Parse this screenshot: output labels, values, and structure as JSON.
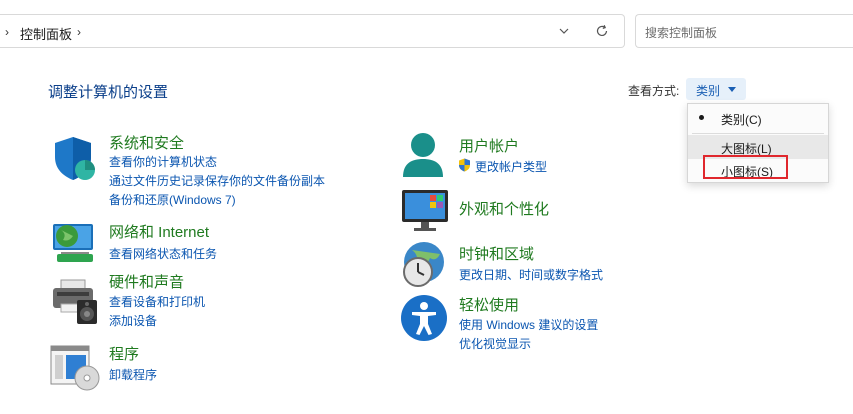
{
  "address": {
    "breadcrumb": "控制面板"
  },
  "search": {
    "placeholder": "搜索控制面板"
  },
  "heading": "调整计算机的设置",
  "view_by": {
    "label": "查看方式:",
    "current": "类别",
    "options": [
      "类别(C)",
      "大图标(L)",
      "小图标(S)"
    ],
    "selected_index": 0,
    "hover_index": 1,
    "highlighted_index": 2
  },
  "categories_left": [
    {
      "title": "系统和安全",
      "icon": "shield-icon",
      "links": [
        "查看你的计算机状态",
        "通过文件历史记录保存你的文件备份副本",
        "备份和还原(Windows 7)"
      ]
    },
    {
      "title": "网络和 Internet",
      "icon": "network-globe-icon",
      "links": [
        "查看网络状态和任务"
      ]
    },
    {
      "title": "硬件和声音",
      "icon": "printer-speaker-icon",
      "links": [
        "查看设备和打印机",
        "添加设备"
      ]
    },
    {
      "title": "程序",
      "icon": "programs-disc-icon",
      "links": [
        "卸载程序"
      ]
    }
  ],
  "categories_right": [
    {
      "title": "用户帐户",
      "icon": "user-icon",
      "links": [
        "更改帐户类型"
      ],
      "link_icon": "uac-shield-icon"
    },
    {
      "title": "外观和个性化",
      "icon": "monitor-icon",
      "links": []
    },
    {
      "title": "时钟和区域",
      "icon": "clock-globe-icon",
      "links": [
        "更改日期、时间或数字格式"
      ]
    },
    {
      "title": "轻松使用",
      "icon": "accessibility-icon",
      "links": [
        "使用 Windows 建议的设置",
        "优化视觉显示"
      ]
    }
  ]
}
